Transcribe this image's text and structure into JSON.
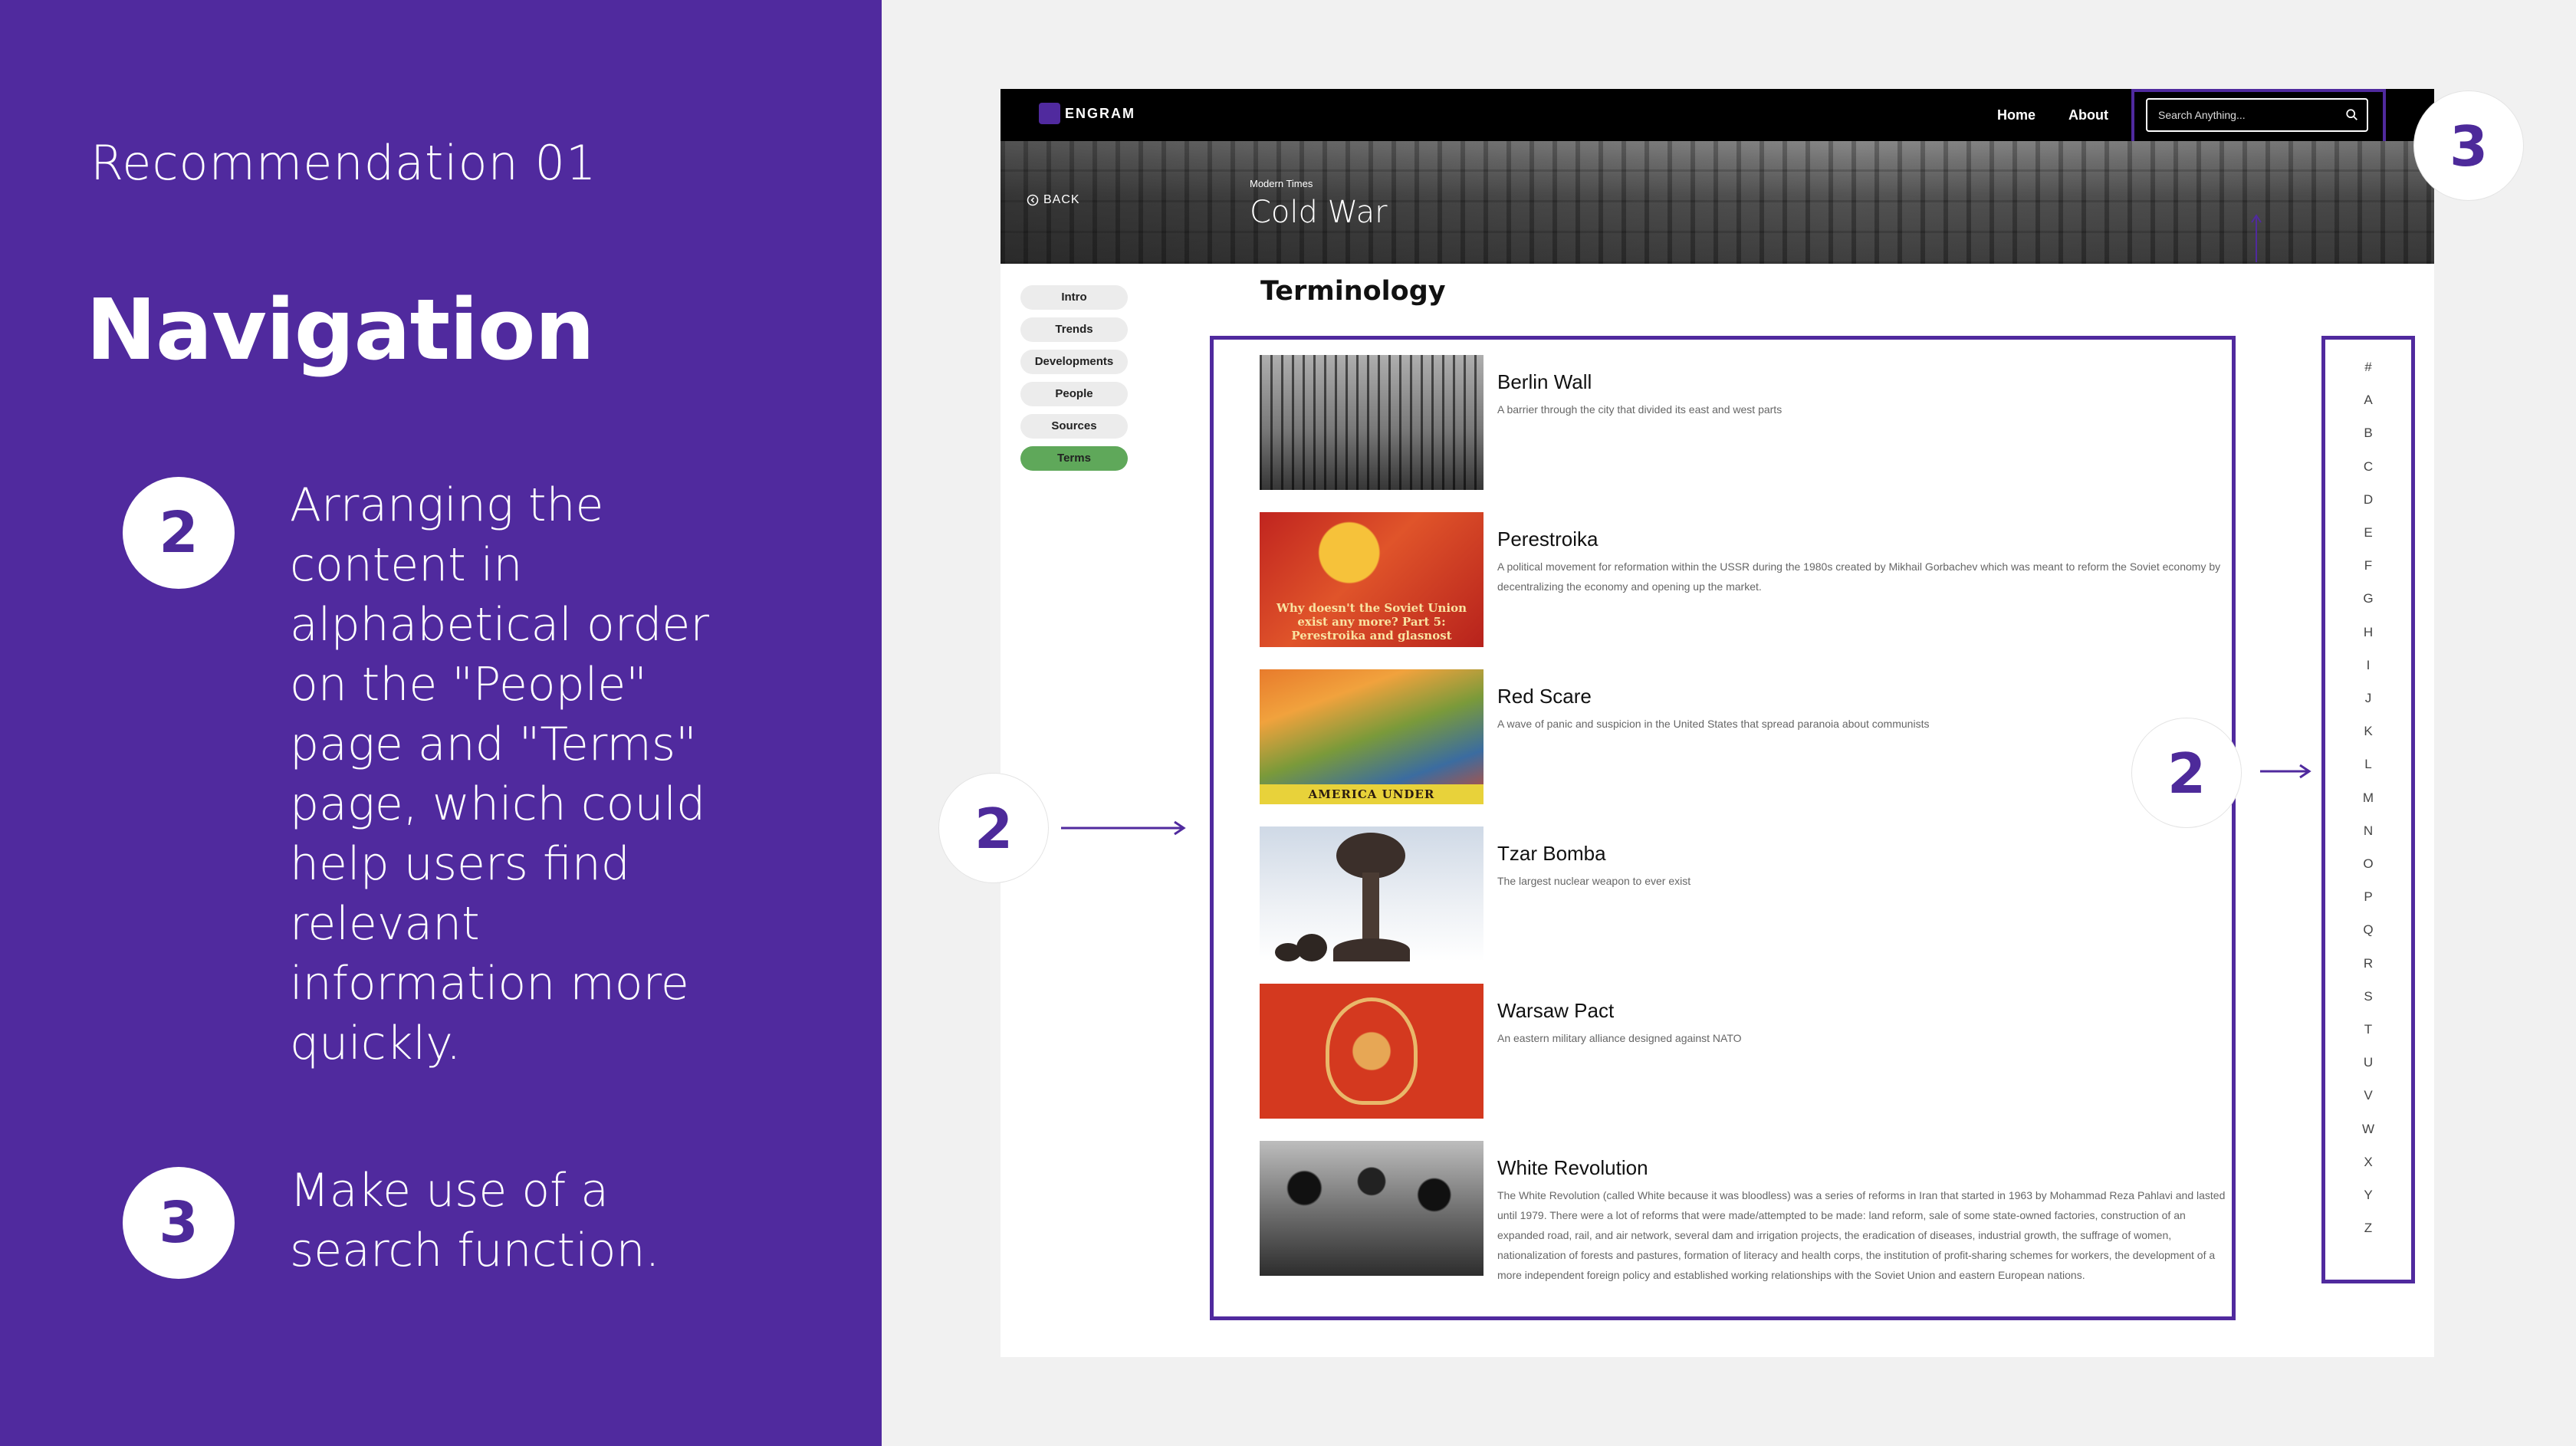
{
  "slide": {
    "eyebrow": "Recommendation 01",
    "title": "Navigation",
    "points": [
      {
        "number": "2",
        "text": "Arranging the content in alphabetical order on the \"People\" page and \"Terms\" page, which could help users find relevant information more quickly."
      },
      {
        "number": "3",
        "text": "Make use of a search function."
      }
    ]
  },
  "site": {
    "logo_text": "ENGRAM",
    "nav": {
      "home": "Home",
      "about": "About"
    },
    "search": {
      "placeholder": "Search Anything..."
    },
    "hero": {
      "back_label": "BACK",
      "eyebrow": "Modern Times",
      "title": "Cold War"
    },
    "sidebar": {
      "items": [
        {
          "label": "Intro",
          "active": false
        },
        {
          "label": "Trends",
          "active": false
        },
        {
          "label": "Developments",
          "active": false
        },
        {
          "label": "People",
          "active": false
        },
        {
          "label": "Sources",
          "active": false
        },
        {
          "label": "Terms",
          "active": true
        }
      ],
      "active_color": "#5fa85a"
    },
    "heading": "Terminology",
    "terms": [
      {
        "title": "Berlin Wall",
        "description": "A barrier through the city that divided its east and west parts"
      },
      {
        "title": "Perestroika",
        "description": "A political movement for reformation within the USSR during the 1980s created by Mikhail Gorbachev which was meant to reform the Soviet economy by decentralizing the economy and opening up the market.",
        "image_caption": "Why doesn't the Soviet Union exist any more? Part 5: Perestroika and glasnost"
      },
      {
        "title": "Red Scare",
        "description": "A wave of panic and suspicion in the United States that spread paranoia about communists",
        "image_caption": "AMERICA UNDER COMMUNISM!"
      },
      {
        "title": "Tzar Bomba",
        "description": "The largest nuclear weapon to ever exist"
      },
      {
        "title": "Warsaw Pact",
        "description": "An eastern military alliance designed against NATO"
      },
      {
        "title": "White Revolution",
        "description": "The White Revolution (called White because it was bloodless) was a series of reforms in Iran that started in 1963 by Mohammad Reza Pahlavi and lasted until 1979. There were a lot of reforms that were made/attempted to be made: land reform, sale of some state-owned factories, construction of an expanded road, rail, and air network, several dam and irrigation projects, the eradication of diseases, industrial growth, the suffrage of women, nationalization of forests and pastures, formation of literacy and health corps, the institution of profit-sharing schemes for workers, the development of a more independent foreign policy and established working relationships with the Soviet Union and eastern European nations."
      }
    ],
    "alphabet": [
      "#",
      "A",
      "B",
      "C",
      "D",
      "E",
      "F",
      "G",
      "H",
      "I",
      "J",
      "K",
      "L",
      "M",
      "N",
      "O",
      "P",
      "Q",
      "R",
      "S",
      "T",
      "U",
      "V",
      "W",
      "X",
      "Y",
      "Z"
    ]
  },
  "annotations": {
    "left_marker": "2",
    "right_marker": "2",
    "search_marker": "3"
  },
  "colors": {
    "brand_purple": "#502a9e",
    "background": "#f1f1f1",
    "active_pill": "#5fa85a"
  }
}
